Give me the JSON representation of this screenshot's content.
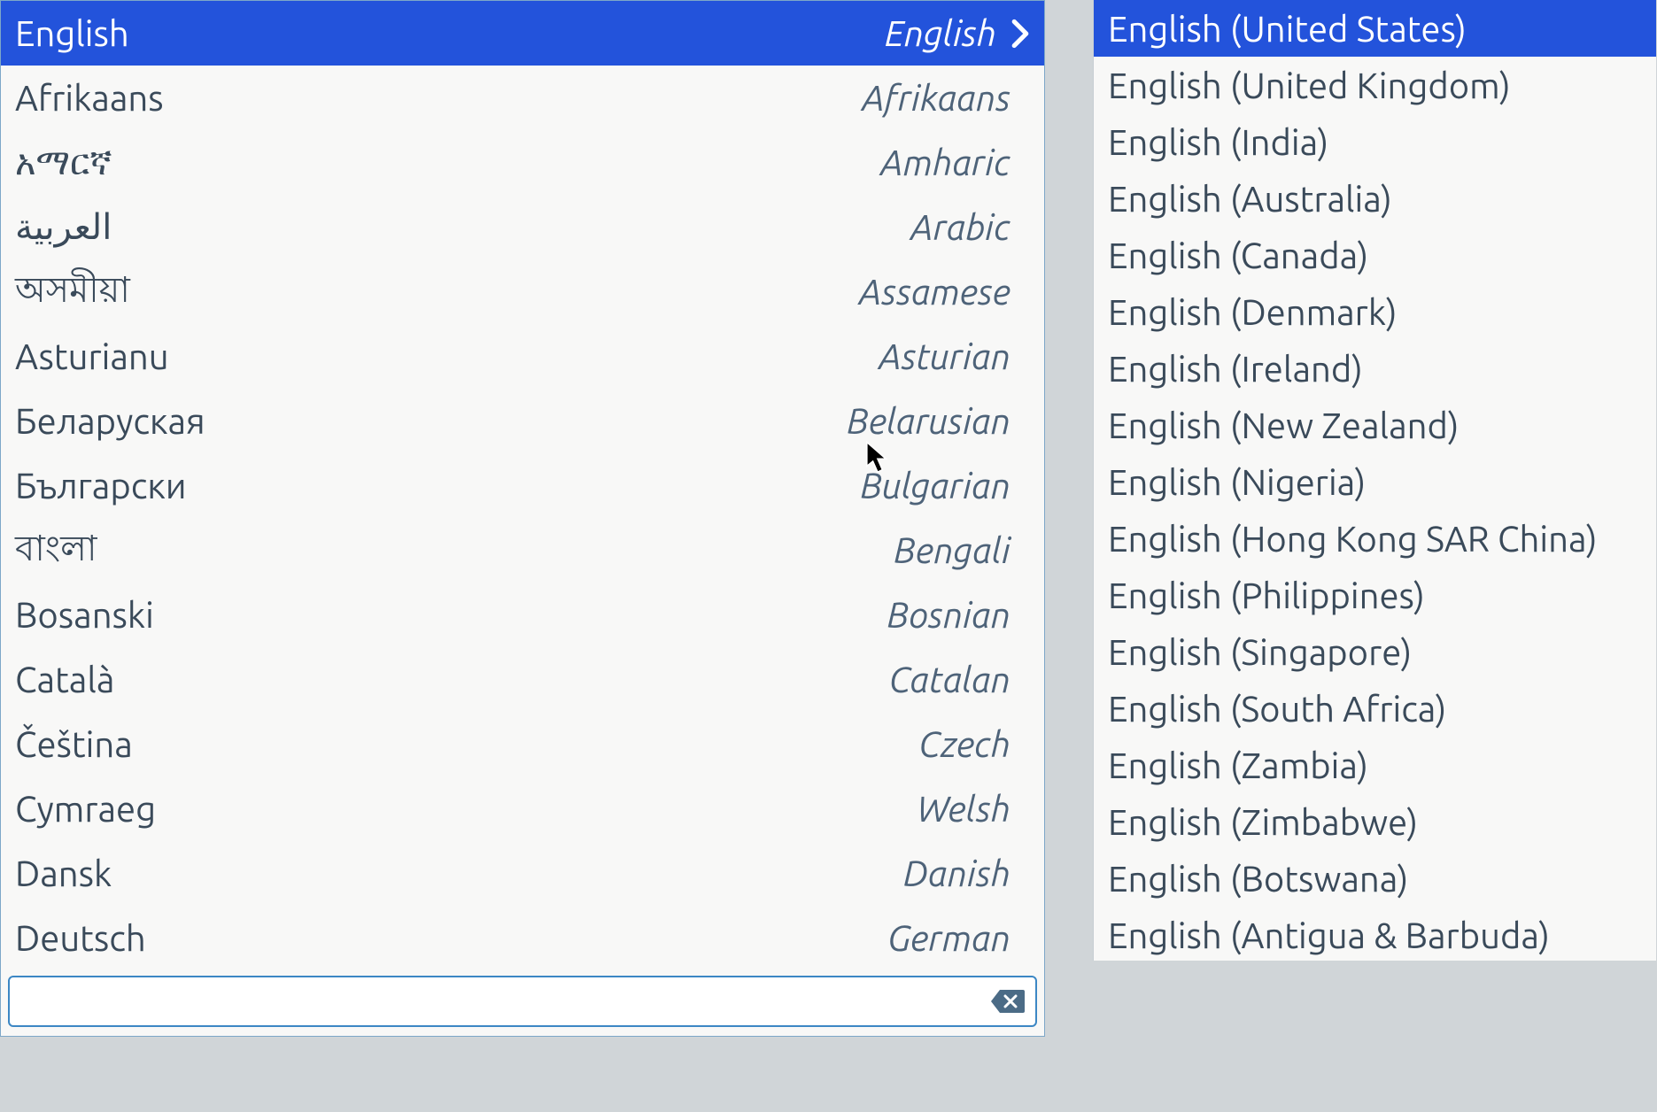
{
  "languages": [
    {
      "native": "English",
      "english": "English",
      "selected": true,
      "hasChildren": true
    },
    {
      "native": "Afrikaans",
      "english": "Afrikaans",
      "selected": false,
      "hasChildren": false
    },
    {
      "native": "አማርኛ",
      "english": "Amharic",
      "selected": false,
      "hasChildren": false
    },
    {
      "native": "العربية",
      "english": "Arabic",
      "selected": false,
      "hasChildren": false
    },
    {
      "native": "অসমীয়া",
      "english": "Assamese",
      "selected": false,
      "hasChildren": false
    },
    {
      "native": "Asturianu",
      "english": "Asturian",
      "selected": false,
      "hasChildren": false
    },
    {
      "native": "Беларуская",
      "english": "Belarusian",
      "selected": false,
      "hasChildren": false
    },
    {
      "native": "Български",
      "english": "Bulgarian",
      "selected": false,
      "hasChildren": false
    },
    {
      "native": "বাংলা",
      "english": "Bengali",
      "selected": false,
      "hasChildren": false
    },
    {
      "native": "Bosanski",
      "english": "Bosnian",
      "selected": false,
      "hasChildren": false
    },
    {
      "native": "Català",
      "english": "Catalan",
      "selected": false,
      "hasChildren": false
    },
    {
      "native": "Čeština",
      "english": "Czech",
      "selected": false,
      "hasChildren": false
    },
    {
      "native": "Cymraeg",
      "english": "Welsh",
      "selected": false,
      "hasChildren": false
    },
    {
      "native": "Dansk",
      "english": "Danish",
      "selected": false,
      "hasChildren": false
    },
    {
      "native": "Deutsch",
      "english": "German",
      "selected": false,
      "hasChildren": false
    }
  ],
  "locales": [
    {
      "label": "English (United States)",
      "selected": true
    },
    {
      "label": "English (United Kingdom)",
      "selected": false
    },
    {
      "label": "English (India)",
      "selected": false
    },
    {
      "label": "English (Australia)",
      "selected": false
    },
    {
      "label": "English (Canada)",
      "selected": false
    },
    {
      "label": "English (Denmark)",
      "selected": false
    },
    {
      "label": "English (Ireland)",
      "selected": false
    },
    {
      "label": "English (New Zealand)",
      "selected": false
    },
    {
      "label": "English (Nigeria)",
      "selected": false
    },
    {
      "label": "English (Hong Kong SAR China)",
      "selected": false
    },
    {
      "label": "English (Philippines)",
      "selected": false
    },
    {
      "label": "English (Singapore)",
      "selected": false
    },
    {
      "label": "English (South Africa)",
      "selected": false
    },
    {
      "label": "English (Zambia)",
      "selected": false
    },
    {
      "label": "English (Zimbabwe)",
      "selected": false
    },
    {
      "label": "English (Botswana)",
      "selected": false
    },
    {
      "label": "English (Antigua & Barbuda)",
      "selected": false
    }
  ],
  "search": {
    "value": "",
    "placeholder": ""
  }
}
